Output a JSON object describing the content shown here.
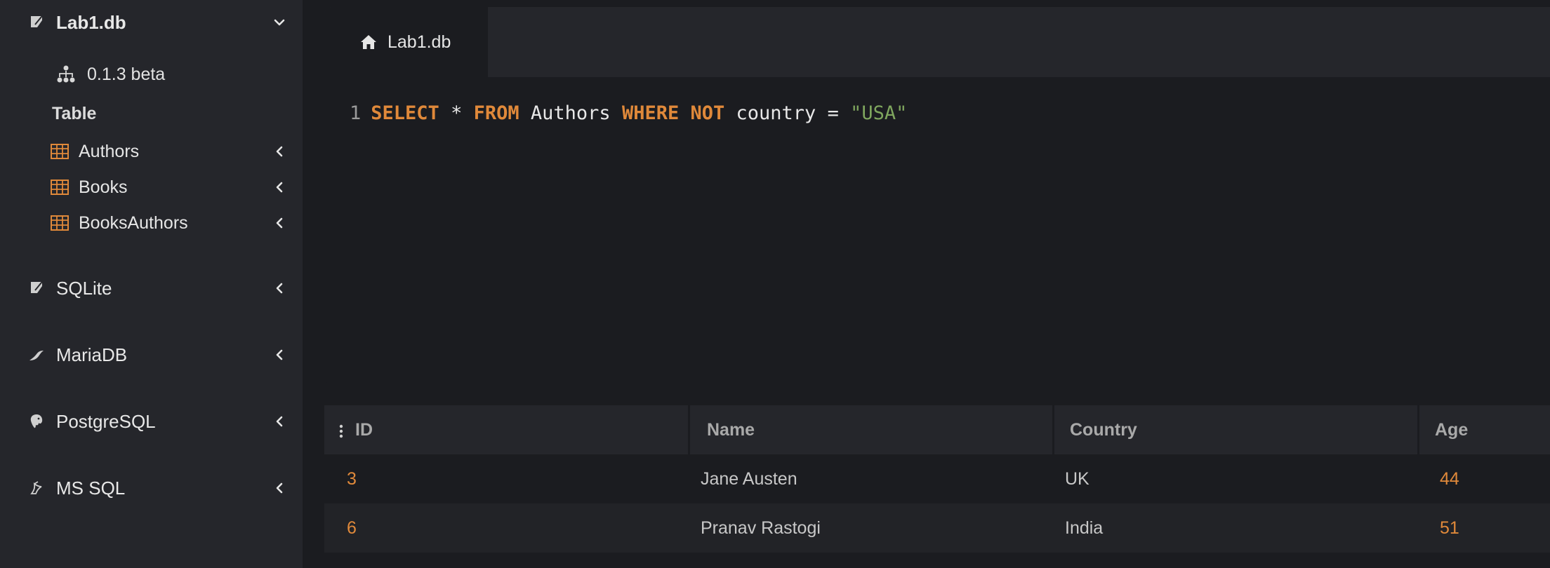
{
  "sidebar": {
    "active_db": {
      "label": "Lab1.db",
      "icon": "sqlite-feather-icon"
    },
    "version": {
      "label": "0.1.3 beta",
      "icon": "schema-tree-icon"
    },
    "table_heading": "Table",
    "tables": [
      {
        "label": "Authors",
        "icon": "table-grid-icon"
      },
      {
        "label": "Books",
        "icon": "table-grid-icon"
      },
      {
        "label": "BooksAuthors",
        "icon": "table-grid-icon"
      }
    ],
    "databases": [
      {
        "label": "SQLite",
        "icon": "sqlite-feather-icon"
      },
      {
        "label": "MariaDB",
        "icon": "mariadb-seal-icon"
      },
      {
        "label": "PostgreSQL",
        "icon": "postgresql-elephant-icon"
      },
      {
        "label": "MS SQL",
        "icon": "mssql-icon"
      }
    ]
  },
  "tabs": [
    {
      "label": "Lab1.db",
      "icon": "home-icon"
    }
  ],
  "editor": {
    "line_number": "1",
    "tokens": {
      "select": "SELECT",
      "star": " * ",
      "from": "FROM",
      "table": " Authors ",
      "where": "WHERE",
      "not": "NOT",
      "rest": " country = ",
      "string": "\"USA\""
    }
  },
  "results": {
    "columns": [
      "ID",
      "Name",
      "Country",
      "Age"
    ],
    "rows": [
      [
        "3",
        "Jane Austen",
        "UK",
        "44"
      ],
      [
        "6",
        "Pranav Rastogi",
        "India",
        "51"
      ]
    ]
  },
  "colors": {
    "accent": "#e0893a",
    "string": "#7fa65e",
    "sidebar_bg": "#25262b",
    "main_bg": "#1b1c20"
  }
}
